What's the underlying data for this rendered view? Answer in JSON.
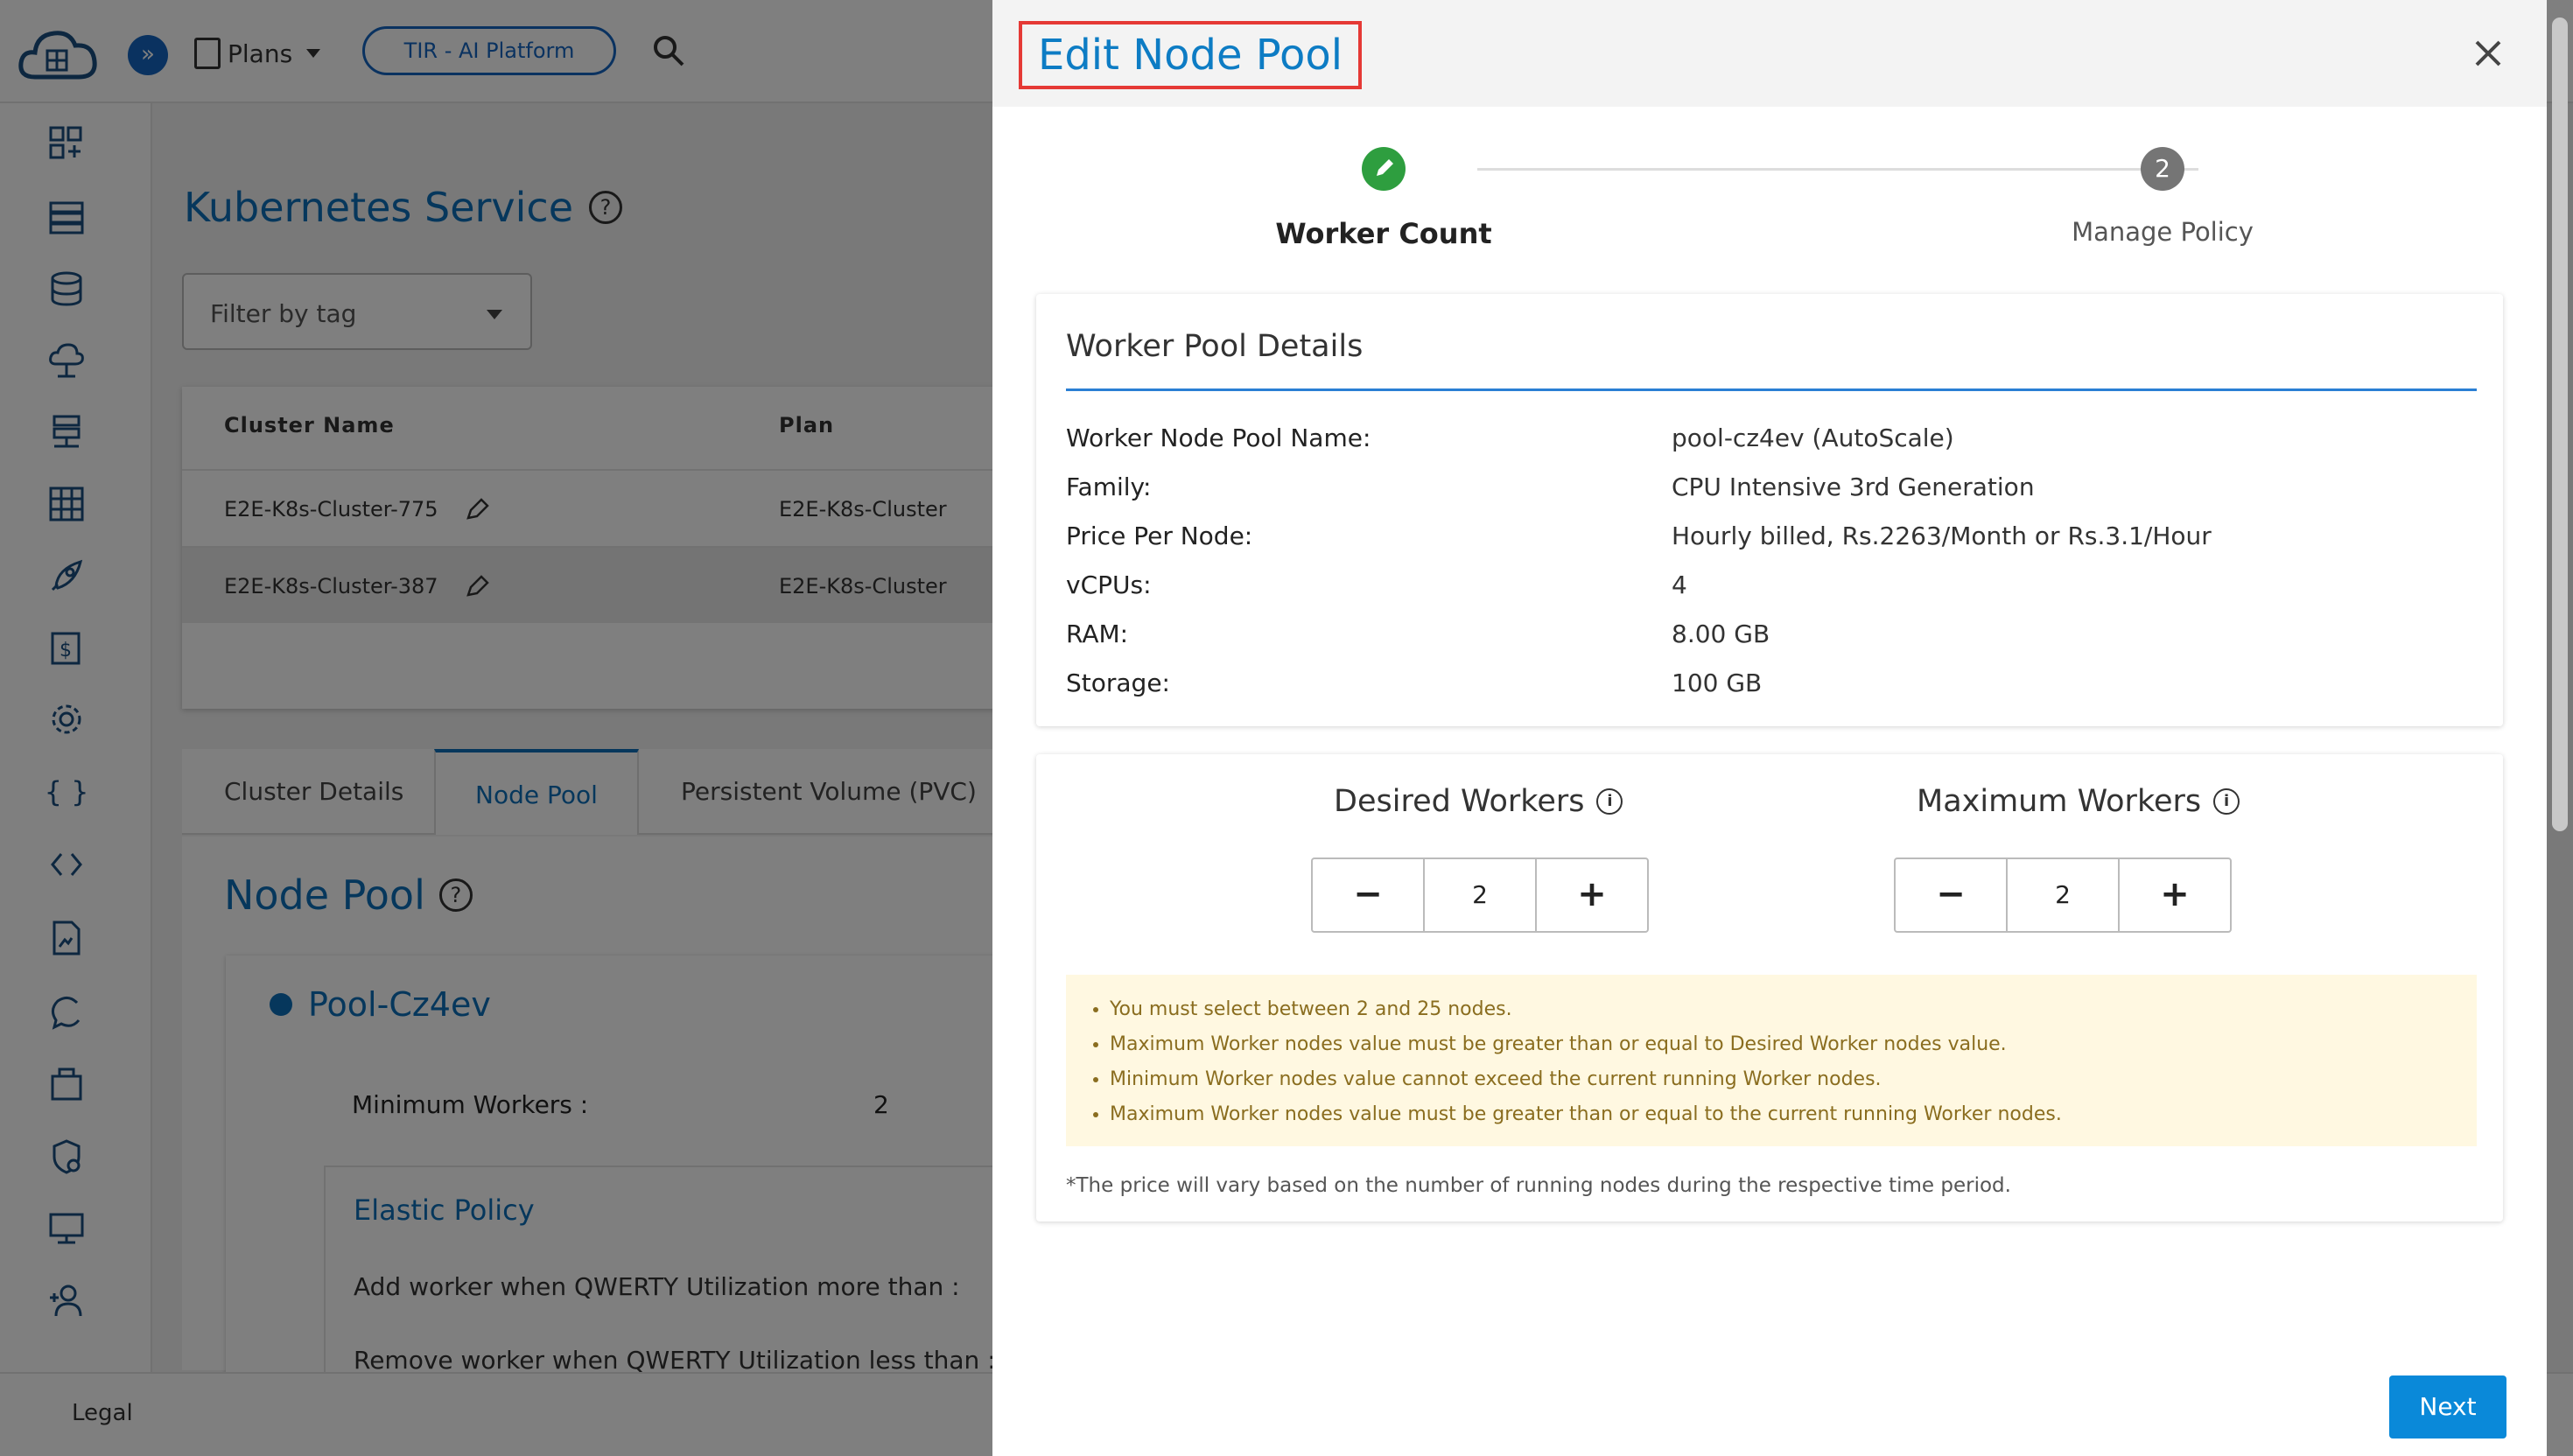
{
  "topbar": {
    "plans_label": "Plans",
    "platform_button": "TIR - AI Platform"
  },
  "page": {
    "title": "Kubernetes Service",
    "filter_placeholder": "Filter by tag"
  },
  "table": {
    "headers": [
      "Cluster Name",
      "Plan"
    ],
    "rows": [
      {
        "name": "E2E-K8s-Cluster-775",
        "plan": "E2E-K8s-Cluster"
      },
      {
        "name": "E2E-K8s-Cluster-387",
        "plan": "E2E-K8s-Cluster"
      }
    ]
  },
  "tabs": [
    "Cluster Details",
    "Node Pool",
    "Persistent Volume (PVC)"
  ],
  "node_pool": {
    "title": "Node Pool",
    "pool_name": "Pool-Cz4ev",
    "min_workers_label": "Minimum Workers :",
    "min_workers_value": "2",
    "elastic_title": "Elastic Policy",
    "add_worker": "Add worker when QWERTY Utilization more than :",
    "remove_worker": "Remove worker when QWERTY Utilization less than :"
  },
  "footer": {
    "legal": "Legal"
  },
  "drawer": {
    "title": "Edit Node Pool",
    "steps": [
      {
        "label": "Worker Count",
        "state": "done"
      },
      {
        "label": "Manage Policy",
        "number": "2"
      }
    ],
    "details": {
      "title": "Worker Pool Details",
      "rows": [
        {
          "label": "Worker Node Pool Name:",
          "value": "pool-cz4ev (AutoScale)"
        },
        {
          "label": "Family:",
          "value": "CPU Intensive 3rd Generation"
        },
        {
          "label": "Price Per Node:",
          "value": "Hourly billed, Rs.2263/Month or Rs.3.1/Hour"
        },
        {
          "label": "vCPUs:",
          "value": "4"
        },
        {
          "label": "RAM:",
          "value": "8.00 GB"
        },
        {
          "label": "Storage:",
          "value": "100 GB"
        }
      ]
    },
    "workers": {
      "desired_label": "Desired Workers",
      "desired_value": "2",
      "max_label": "Maximum Workers",
      "max_value": "2",
      "notes": [
        "You must select between 2 and 25 nodes.",
        "Maximum Worker nodes value must be greater than or equal to Desired Worker nodes value.",
        "Minimum Worker nodes value cannot exceed the current running Worker nodes.",
        "Maximum Worker nodes value must be greater than or equal to the current running Worker nodes."
      ],
      "price_note": "*The price will vary based on the number of running nodes during the respective time period."
    },
    "next_button": "Next"
  },
  "colors": {
    "accent": "#0d7cc4",
    "done_step": "#2e9e3f",
    "highlight_border": "#e53935",
    "notes_bg": "#fff8e1"
  }
}
